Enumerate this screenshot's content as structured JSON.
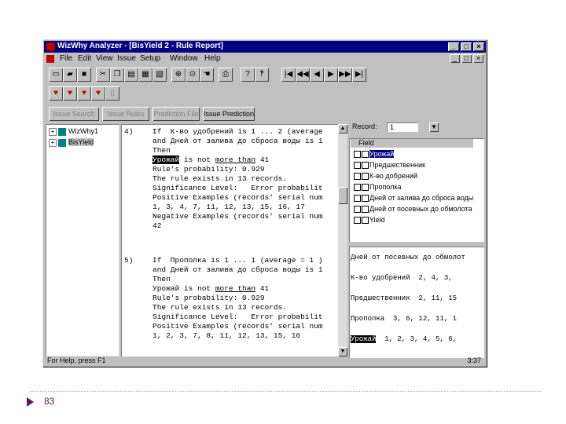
{
  "window": {
    "title": "WizWhy Analyzer - [BisYield 2 - Rule Report]",
    "min": "_",
    "max": "□",
    "close": "×"
  },
  "menu": [
    "File",
    "Edit",
    "View",
    "Issue",
    "Setup",
    "Window",
    "Help"
  ],
  "menu_buttons": [
    "_",
    "□",
    "×"
  ],
  "toolbar": {
    "left_icons": [
      "new-icon",
      "open-icon",
      "save-icon",
      "cut-icon",
      "copy-icon",
      "paste-icon",
      "edit-icon",
      "delete-icon",
      "zoom-icon",
      "find-icon",
      "hand-icon",
      "print-icon",
      "help-icon",
      "context-help-icon"
    ],
    "nav_icons": [
      "first-icon",
      "prev-page-icon",
      "prev-icon",
      "next-icon",
      "next-page-icon",
      "last-icon"
    ],
    "nav_glyphs": [
      "|◀",
      "◀◀",
      "◀",
      "▶",
      "▶▶",
      "▶|"
    ]
  },
  "tabs": [
    "Issue Search",
    "Issue Rules",
    "Prediction File",
    "Issue Prediction"
  ],
  "tree": [
    {
      "label": "WizWhy1",
      "expander": "+"
    },
    {
      "label": "BisYield",
      "expander": "+"
    }
  ],
  "report": {
    "rules": [
      {
        "num": "4)",
        "lines": [
          {
            "t": "If  К-во удобрений is 1 ... 2 (average"
          },
          {
            "t": "and Дней от залива до сброса воды is 1"
          },
          {
            "t": "Then"
          },
          {
            "t": "Урожай",
            "hl": true,
            "rest": " is not ",
            "ul": "more than",
            "tail": " 41"
          },
          {
            "t": "Rule's probability: 0.929"
          },
          {
            "t": "The rule exists in 13 records."
          },
          {
            "t": "Significance Level:   Error probabilit"
          },
          {
            "t": "Positive Examples (records' serial num"
          },
          {
            "t": "1, 3, 4, 7, 11, 12, 13, 15, 16, 17"
          },
          {
            "t": "Negative Examples (records' serial num"
          },
          {
            "t": "42"
          }
        ]
      },
      {
        "num": "5)",
        "lines": [
          {
            "t": "If  Прополка is 1 ... 1 (average = 1 )"
          },
          {
            "t": "and Дней от залива до сброса воды is 1"
          },
          {
            "t": "Then"
          },
          {
            "t": "Урожай is not ",
            "ul": "more than",
            "tail": " 41"
          },
          {
            "t": "Rule's probability: 0.929"
          },
          {
            "t": "The rule exists in 13 records."
          },
          {
            "t": "Significance Level:   Error probabilit"
          },
          {
            "t": "Positive Examples (records' serial num"
          },
          {
            "t": "1, 2, 3, 7, 8, 11, 12, 13, 15, 16"
          }
        ]
      }
    ]
  },
  "record": {
    "label": "Record:",
    "value": "1",
    "button": "▼"
  },
  "fields": {
    "header": "Field",
    "items": [
      "Урожай",
      "Предшественник",
      "К-во добрений",
      "Прополка",
      "Дней от залива до сброса воды",
      "Дней от посевных до обмолота",
      "Yield"
    ],
    "selected_index": 0
  },
  "detail_lines": [
    {
      "name": "Дней от посевных до обмолот",
      "vals": ""
    },
    {
      "name": "К-во удобрений",
      "vals": "  2, 4, 3,"
    },
    {
      "name": "Предшественник",
      "vals": "  2, 11, 15"
    },
    {
      "name": "Прополка",
      "vals": "  3, 6, 12, 11, 1"
    },
    {
      "name": "Урожай",
      "vals": "  1, 2, 3, 4, 5, 6,",
      "hl": true
    }
  ],
  "status": {
    "left": "For Help, press F1",
    "right": "3:37"
  },
  "slide_number": "83"
}
